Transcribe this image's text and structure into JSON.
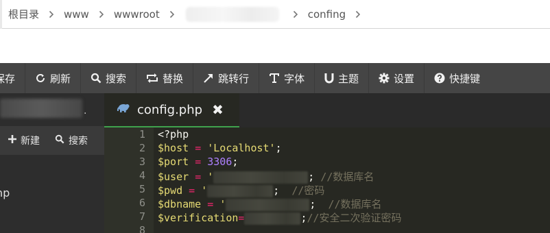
{
  "breadcrumb": {
    "items": [
      "根目录",
      "www",
      "wwwroot",
      "confing"
    ]
  },
  "toolbar": {
    "buttons": [
      {
        "label": "保存",
        "icon": "save-icon"
      },
      {
        "label": "刷新",
        "icon": "refresh-icon"
      },
      {
        "label": "搜索",
        "icon": "search-icon"
      },
      {
        "label": "替换",
        "icon": "replace-icon"
      },
      {
        "label": "跳转行",
        "icon": "goto-line-icon"
      },
      {
        "label": "字体",
        "icon": "font-icon"
      },
      {
        "label": "主题",
        "icon": "theme-icon"
      },
      {
        "label": "设置",
        "icon": "gear-icon"
      },
      {
        "label": "快捷键",
        "icon": "help-icon"
      }
    ]
  },
  "sidebar": {
    "dot": ".",
    "new_label": "新建",
    "search_label": "搜索",
    "file_label": "hp"
  },
  "tab": {
    "filename": "config.php",
    "close": "✖"
  },
  "code": {
    "line_numbers": [
      "1",
      "2",
      "3",
      "4",
      "5",
      "6",
      "7",
      "8"
    ],
    "open_tag": "<?php",
    "host_var": "$host",
    "host_value": "'Localhost'",
    "port_var": "$port",
    "port_value": "3306",
    "user_var": "$user",
    "user_comment": "//数据库名",
    "pwd_var": "$pwd",
    "pwd_comment": "//密码",
    "dbname_var": "$dbname",
    "dbname_comment": "//数据库名",
    "verification_var": "$verification",
    "verification_comment": "//安全二次验证密码"
  }
}
